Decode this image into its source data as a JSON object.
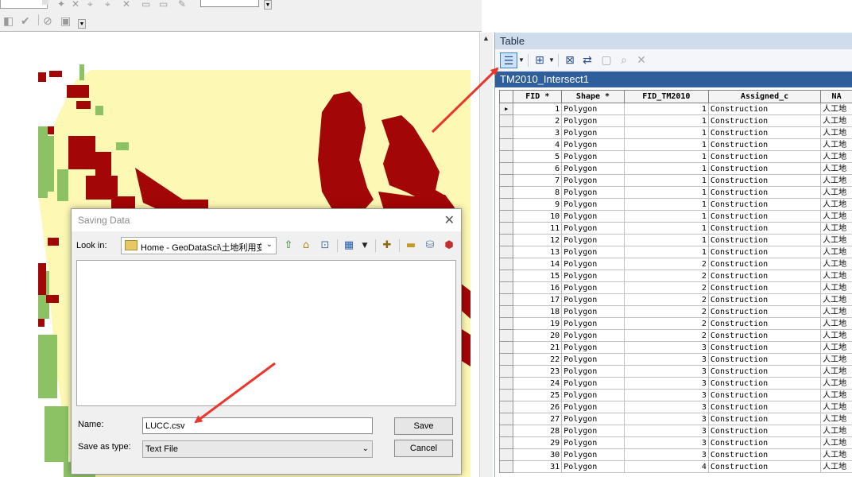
{
  "colors": {
    "built_up": "#a30606",
    "farmland": "#fdf8b4",
    "vegetation": "#8cc264",
    "annotation": "#e8372d",
    "table_header": "#2f5f9a"
  },
  "icons": {
    "main_toolbar": [
      "map-tool-icon",
      "identify-icon",
      "options-icon",
      "edit-icon"
    ],
    "table_toolbar": [
      "table-options-icon",
      "related-tables-icon",
      "select-by-attributes-icon",
      "switch-selection-icon",
      "clear-selection-icon",
      "zoom-to-selected-icon",
      "delete-selected-icon"
    ],
    "dialog_toolbar": [
      "up-one-level-icon",
      "home-icon",
      "connect-folder-icon",
      "view-menu-icon",
      "new-folder-icon",
      "folder-icon",
      "database-icon",
      "toolbox-icon"
    ]
  },
  "table": {
    "window_title": "Table",
    "tab_name": "TM2010_Intersect1",
    "columns": [
      "FID *",
      "Shape *",
      "FID_TM2010",
      "Assigned_c",
      "NA"
    ],
    "rows": [
      [
        "1",
        "Polygon",
        "1",
        "Construction",
        "人工地"
      ],
      [
        "2",
        "Polygon",
        "1",
        "Construction",
        "人工地"
      ],
      [
        "3",
        "Polygon",
        "1",
        "Construction",
        "人工地"
      ],
      [
        "4",
        "Polygon",
        "1",
        "Construction",
        "人工地"
      ],
      [
        "5",
        "Polygon",
        "1",
        "Construction",
        "人工地"
      ],
      [
        "6",
        "Polygon",
        "1",
        "Construction",
        "人工地"
      ],
      [
        "7",
        "Polygon",
        "1",
        "Construction",
        "人工地"
      ],
      [
        "8",
        "Polygon",
        "1",
        "Construction",
        "人工地"
      ],
      [
        "9",
        "Polygon",
        "1",
        "Construction",
        "人工地"
      ],
      [
        "10",
        "Polygon",
        "1",
        "Construction",
        "人工地"
      ],
      [
        "11",
        "Polygon",
        "1",
        "Construction",
        "人工地"
      ],
      [
        "12",
        "Polygon",
        "1",
        "Construction",
        "人工地"
      ],
      [
        "13",
        "Polygon",
        "1",
        "Construction",
        "人工地"
      ],
      [
        "14",
        "Polygon",
        "2",
        "Construction",
        "人工地"
      ],
      [
        "15",
        "Polygon",
        "2",
        "Construction",
        "人工地"
      ],
      [
        "16",
        "Polygon",
        "2",
        "Construction",
        "人工地"
      ],
      [
        "17",
        "Polygon",
        "2",
        "Construction",
        "人工地"
      ],
      [
        "18",
        "Polygon",
        "2",
        "Construction",
        "人工地"
      ],
      [
        "19",
        "Polygon",
        "2",
        "Construction",
        "人工地"
      ],
      [
        "20",
        "Polygon",
        "2",
        "Construction",
        "人工地"
      ],
      [
        "21",
        "Polygon",
        "3",
        "Construction",
        "人工地"
      ],
      [
        "22",
        "Polygon",
        "3",
        "Construction",
        "人工地"
      ],
      [
        "23",
        "Polygon",
        "3",
        "Construction",
        "人工地"
      ],
      [
        "24",
        "Polygon",
        "3",
        "Construction",
        "人工地"
      ],
      [
        "25",
        "Polygon",
        "3",
        "Construction",
        "人工地"
      ],
      [
        "26",
        "Polygon",
        "3",
        "Construction",
        "人工地"
      ],
      [
        "27",
        "Polygon",
        "3",
        "Construction",
        "人工地"
      ],
      [
        "28",
        "Polygon",
        "3",
        "Construction",
        "人工地"
      ],
      [
        "29",
        "Polygon",
        "3",
        "Construction",
        "人工地"
      ],
      [
        "30",
        "Polygon",
        "3",
        "Construction",
        "人工地"
      ],
      [
        "31",
        "Polygon",
        "4",
        "Construction",
        "人工地"
      ]
    ],
    "current_row_marker": "▶"
  },
  "dialog": {
    "title": "Saving Data",
    "close_glyph": "✕",
    "look_in_label": "Look in:",
    "look_in_value": "Home - GeoDataSci\\土地利用变",
    "name_label": "Name:",
    "name_value": "LUCC.csv",
    "save_as_type_label": "Save as type:",
    "save_as_type_value": "Text File",
    "save_button": "Save",
    "cancel_button": "Cancel"
  }
}
